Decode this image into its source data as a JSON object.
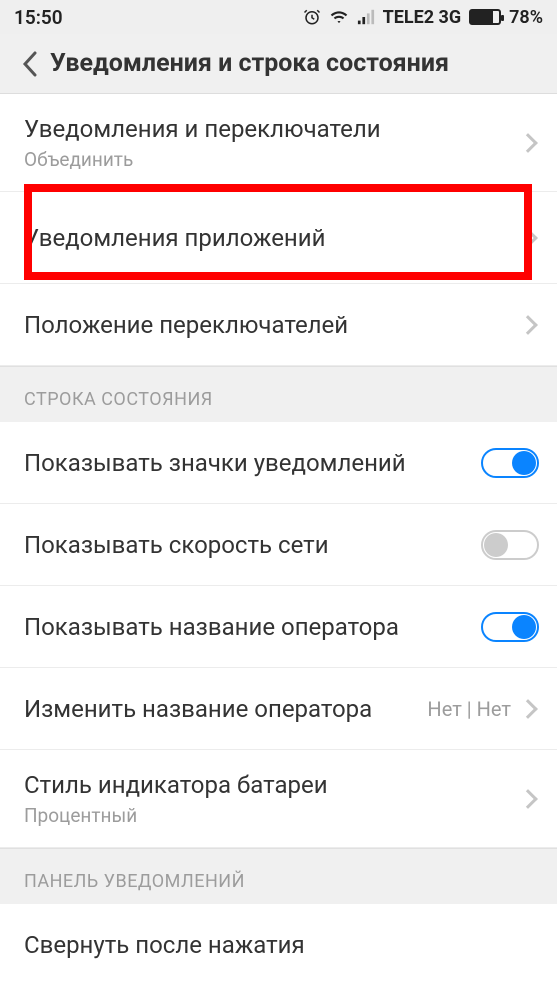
{
  "statusbar": {
    "time": "15:50",
    "carrier": "TELE2 3G",
    "battery_pct": "78%"
  },
  "header": {
    "title": "Уведомления и строка состояния"
  },
  "rows": {
    "notif_toggles": {
      "title": "Уведомления и переключатели",
      "sub": "Объединить"
    },
    "app_notif": {
      "title": "Уведомления приложений"
    },
    "toggle_pos": {
      "title": "Положение переключателей"
    }
  },
  "section1": {
    "header": "СТРОКА СОСТОЯНИЯ",
    "show_icons": {
      "title": "Показывать значки уведомлений"
    },
    "show_speed": {
      "title": "Показывать скорость сети"
    },
    "show_carrier": {
      "title": "Показывать название оператора"
    },
    "edit_carrier": {
      "title": "Изменить название оператора",
      "value": "Нет | Нет"
    },
    "batt_style": {
      "title": "Стиль индикатора батареи",
      "sub": "Процентный"
    }
  },
  "section2": {
    "header": "ПАНЕЛЬ УВЕДОМЛЕНИЙ",
    "collapse": {
      "title": "Свернуть после нажатия"
    }
  }
}
